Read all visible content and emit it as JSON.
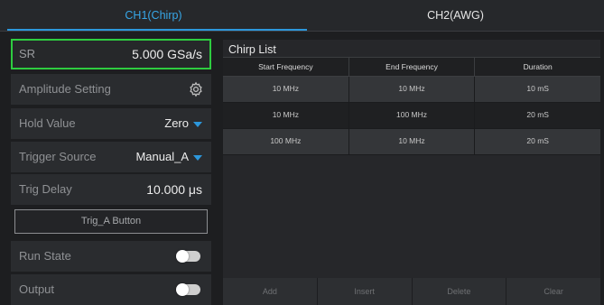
{
  "tabs": [
    {
      "label": "CH1(Chirp)",
      "active": true
    },
    {
      "label": "CH2(AWG)",
      "active": false
    }
  ],
  "settings": {
    "sr": {
      "label": "SR",
      "value": "5.000 GSa/s"
    },
    "amplitude": {
      "label": "Amplitude Setting",
      "icon": "gear-icon"
    },
    "hold_value": {
      "label": "Hold Value",
      "value": "Zero"
    },
    "trigger_source": {
      "label": "Trigger Source",
      "value": "Manual_A"
    },
    "trig_delay": {
      "label": "Trig Delay",
      "value": "10.000 μs"
    },
    "trig_button": {
      "label": "Trig_A Button"
    },
    "run_state": {
      "label": "Run State",
      "on": false
    },
    "output": {
      "label": "Output",
      "on": false
    }
  },
  "chirp_list": {
    "title": "Chirp List",
    "columns": [
      "Start Frequency",
      "End Frequency",
      "Duration"
    ],
    "rows": [
      [
        "10 MHz",
        "10 MHz",
        "10 mS"
      ],
      [
        "10 MHz",
        "100 MHz",
        "20 mS"
      ],
      [
        "100 MHz",
        "10 MHz",
        "20 mS"
      ]
    ],
    "buttons": [
      "Add",
      "Insert",
      "Delete",
      "Clear"
    ]
  },
  "colors": {
    "accent": "#2c97db",
    "selection_border": "#2ecc40"
  }
}
